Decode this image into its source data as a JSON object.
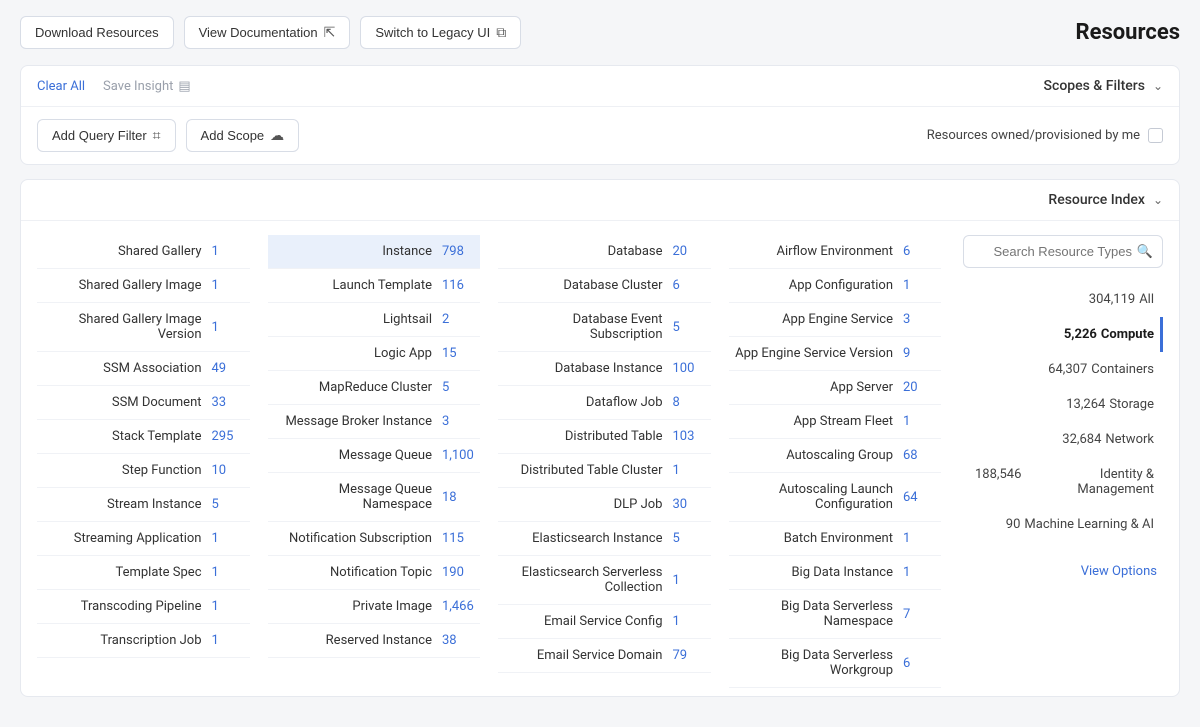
{
  "header": {
    "title": "Resources",
    "actions": {
      "switch_legacy": "Switch to Legacy UI",
      "view_docs": "View Documentation",
      "download": "Download Resources"
    }
  },
  "scopes": {
    "title": "Scopes & Filters",
    "save_insight": "Save Insight",
    "clear_all": "Clear All",
    "owned_label": "Resources owned/provisioned by me",
    "add_scope": "Add Scope",
    "add_query_filter": "Add Query Filter"
  },
  "index": {
    "title": "Resource Index",
    "search_placeholder": "Search Resource Types",
    "view_options": "View Options",
    "categories": [
      {
        "label": "All",
        "count": "304,119"
      },
      {
        "label": "Compute",
        "count": "5,226"
      },
      {
        "label": "Containers",
        "count": "64,307"
      },
      {
        "label": "Storage",
        "count": "13,264"
      },
      {
        "label": "Network",
        "count": "32,684"
      },
      {
        "label": "Identity & Management",
        "count": "188,546"
      },
      {
        "label": "Machine Learning & AI",
        "count": "90"
      }
    ],
    "active_category_index": 1,
    "columns": [
      [
        {
          "label": "Airflow Environment",
          "count": "6"
        },
        {
          "label": "App Configuration",
          "count": "1"
        },
        {
          "label": "App Engine Service",
          "count": "3"
        },
        {
          "label": "App Engine Service Version",
          "count": "9"
        },
        {
          "label": "App Server",
          "count": "20"
        },
        {
          "label": "App Stream Fleet",
          "count": "1"
        },
        {
          "label": "Autoscaling Group",
          "count": "68"
        },
        {
          "label": "Autoscaling Launch Configuration",
          "count": "64"
        },
        {
          "label": "Batch Environment",
          "count": "1"
        },
        {
          "label": "Big Data Instance",
          "count": "1"
        },
        {
          "label": "Big Data Serverless Namespace",
          "count": "7"
        },
        {
          "label": "Big Data Serverless Workgroup",
          "count": "6"
        }
      ],
      [
        {
          "label": "Database",
          "count": "20"
        },
        {
          "label": "Database Cluster",
          "count": "6"
        },
        {
          "label": "Database Event Subscription",
          "count": "5"
        },
        {
          "label": "Database Instance",
          "count": "100"
        },
        {
          "label": "Dataflow Job",
          "count": "8"
        },
        {
          "label": "Distributed Table",
          "count": "103"
        },
        {
          "label": "Distributed Table Cluster",
          "count": "1"
        },
        {
          "label": "DLP Job",
          "count": "30"
        },
        {
          "label": "Elasticsearch Instance",
          "count": "5"
        },
        {
          "label": "Elasticsearch Serverless Collection",
          "count": "1"
        },
        {
          "label": "Email Service Config",
          "count": "1"
        },
        {
          "label": "Email Service Domain",
          "count": "79"
        }
      ],
      [
        {
          "label": "Instance",
          "count": "798",
          "highlight": true
        },
        {
          "label": "Launch Template",
          "count": "116"
        },
        {
          "label": "Lightsail",
          "count": "2"
        },
        {
          "label": "Logic App",
          "count": "15"
        },
        {
          "label": "MapReduce Cluster",
          "count": "5"
        },
        {
          "label": "Message Broker Instance",
          "count": "3"
        },
        {
          "label": "Message Queue",
          "count": "1,100"
        },
        {
          "label": "Message Queue Namespace",
          "count": "18"
        },
        {
          "label": "Notification Subscription",
          "count": "115"
        },
        {
          "label": "Notification Topic",
          "count": "190"
        },
        {
          "label": "Private Image",
          "count": "1,466"
        },
        {
          "label": "Reserved Instance",
          "count": "38"
        }
      ],
      [
        {
          "label": "Shared Gallery",
          "count": "1"
        },
        {
          "label": "Shared Gallery Image",
          "count": "1"
        },
        {
          "label": "Shared Gallery Image Version",
          "count": "1"
        },
        {
          "label": "SSM Association",
          "count": "49"
        },
        {
          "label": "SSM Document",
          "count": "33"
        },
        {
          "label": "Stack Template",
          "count": "295"
        },
        {
          "label": "Step Function",
          "count": "10"
        },
        {
          "label": "Stream Instance",
          "count": "5"
        },
        {
          "label": "Streaming Application",
          "count": "1"
        },
        {
          "label": "Template Spec",
          "count": "1"
        },
        {
          "label": "Transcoding Pipeline",
          "count": "1"
        },
        {
          "label": "Transcription Job",
          "count": "1"
        }
      ]
    ]
  }
}
